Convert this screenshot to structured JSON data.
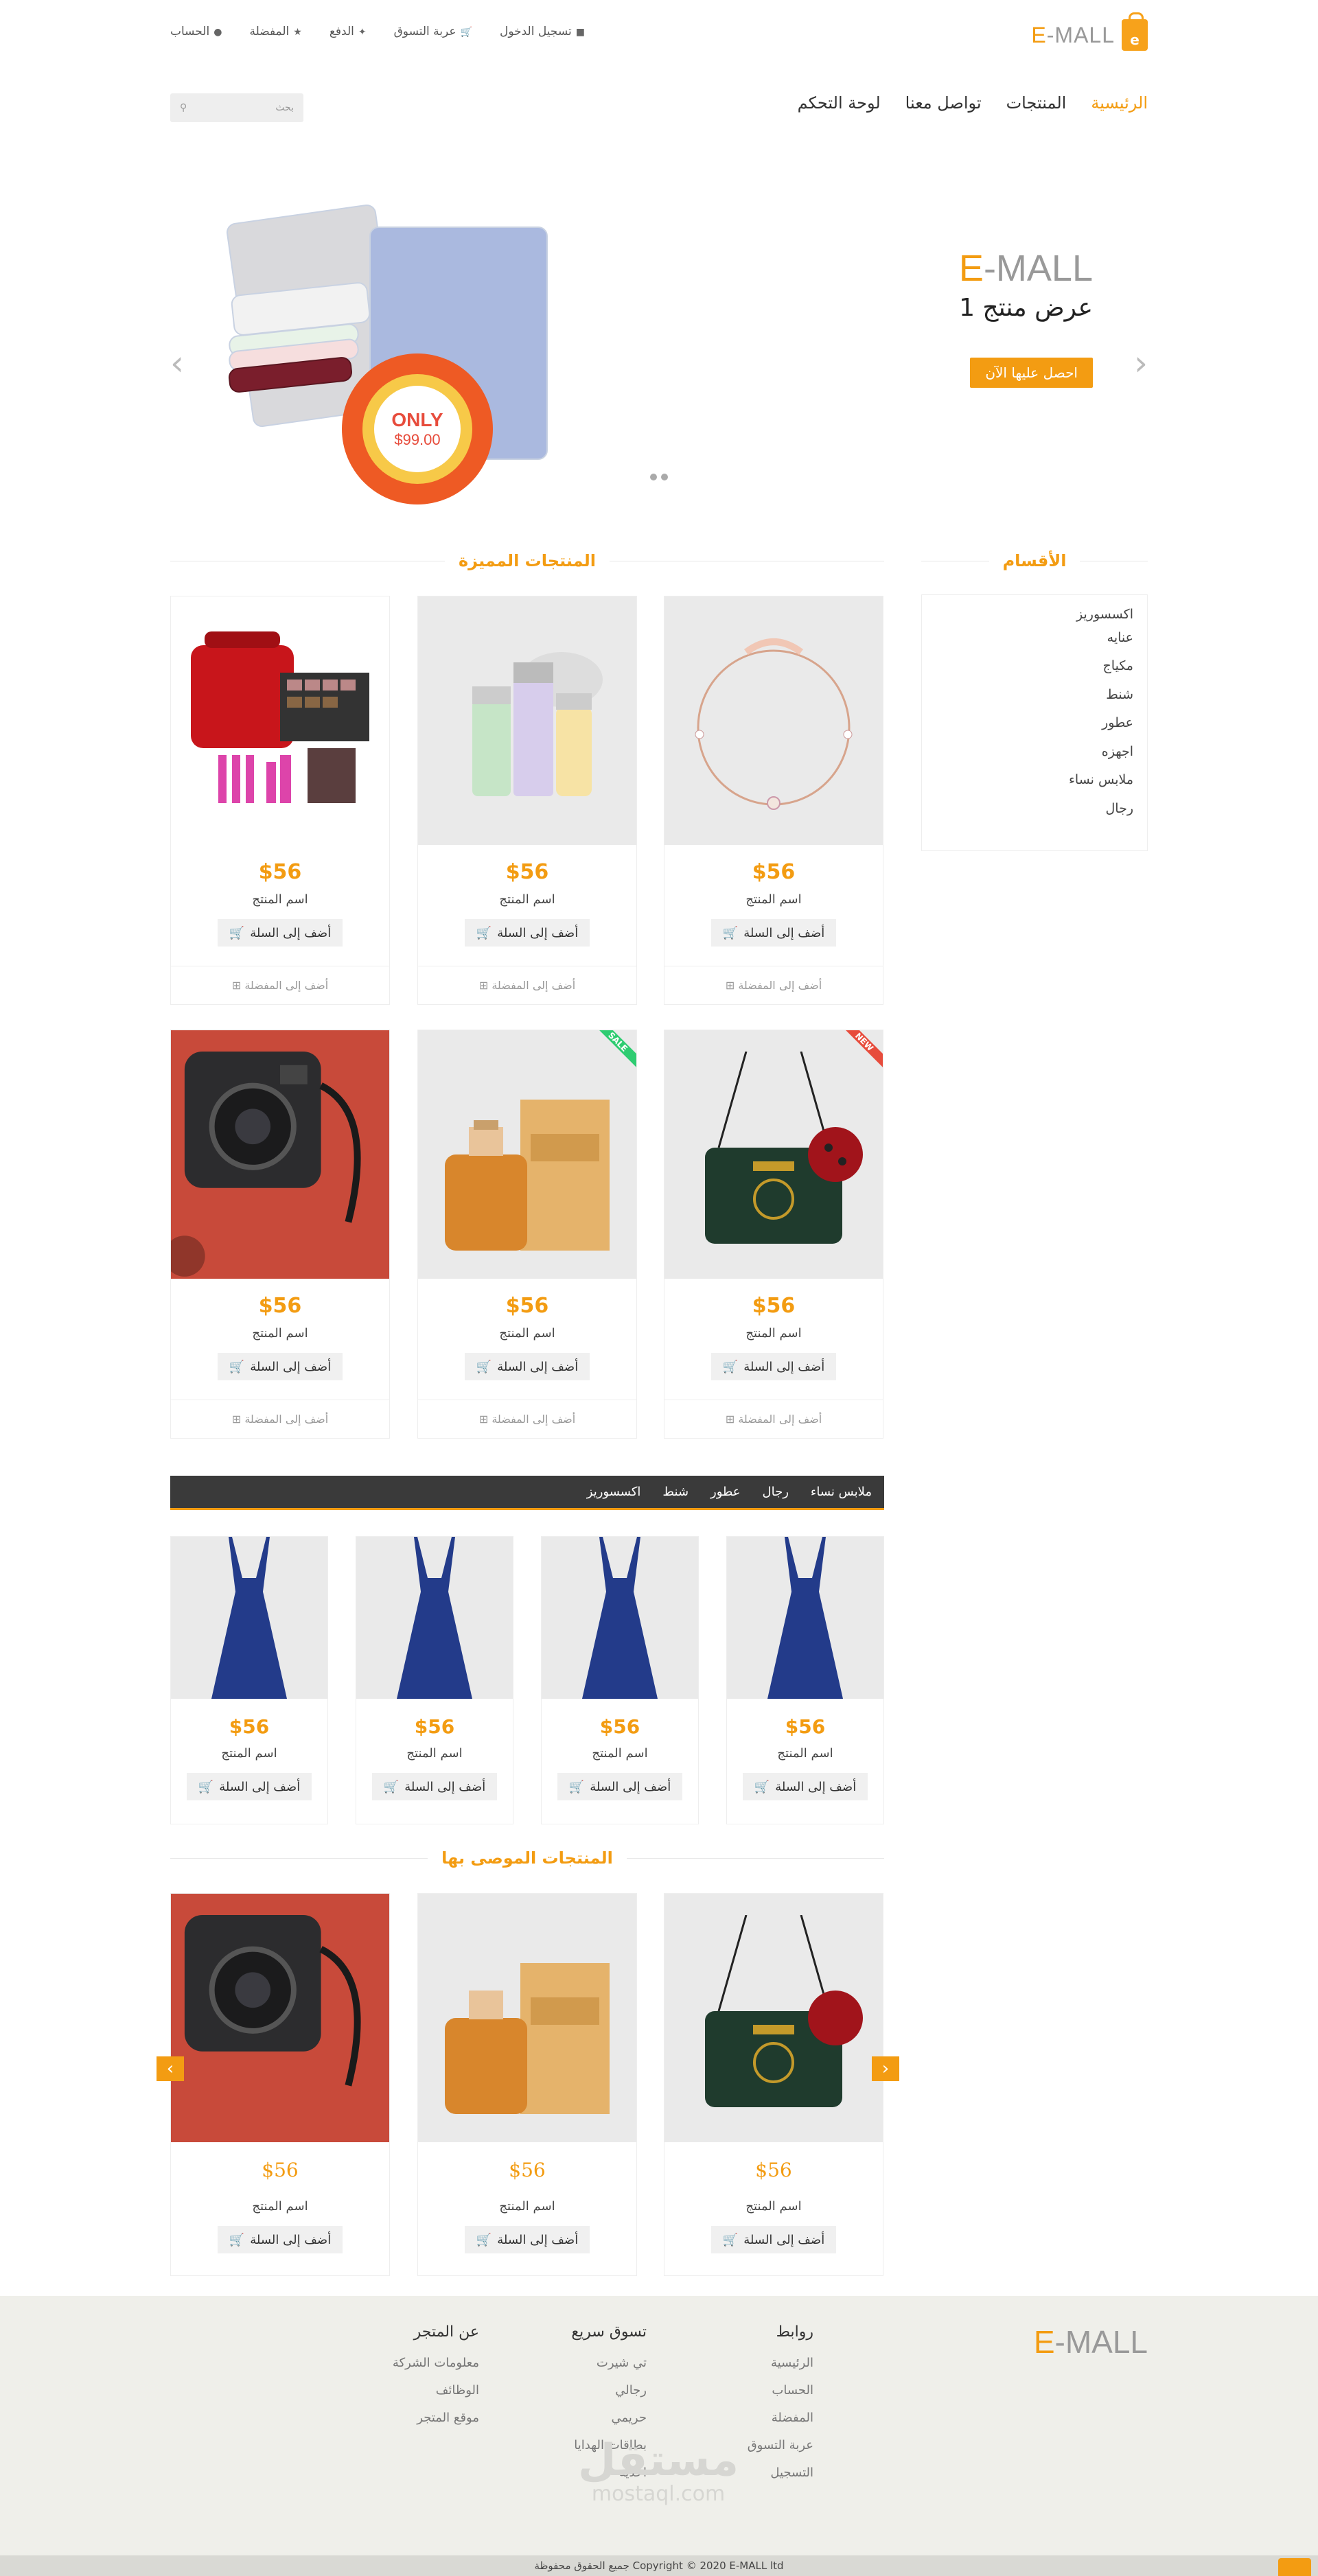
{
  "header": {
    "logo": {
      "prefix": "E",
      "rest": "-MALL",
      "icon_letter": "e"
    },
    "top_links": [
      {
        "label": "الحساب",
        "icon": "user-icon"
      },
      {
        "label": "المفضلة",
        "icon": "star-icon"
      },
      {
        "label": "الدفع",
        "icon": "crosshair-icon"
      },
      {
        "label": "عربة التسوق",
        "icon": "cart-icon"
      },
      {
        "label": "تسجيل الدخول",
        "icon": "lock-icon"
      }
    ],
    "menu": [
      "الرئيسية",
      "المنتجات",
      "تواصل معنا",
      "لوحة التحكم"
    ],
    "search_placeholder": "بحث"
  },
  "slider": {
    "brand_prefix": "E",
    "brand_rest": "-MALL",
    "title": "عرض منتج 1",
    "cta": "احصل عليها الآن",
    "badge_top": "ONLY",
    "badge_price": "$99.00"
  },
  "categories": {
    "title": "الأقسام",
    "items": [
      "اكسسوريز",
      "عنايه",
      "مكياج",
      "شنط",
      "عطور",
      "اجهزه",
      "ملابس نساء",
      "رجال"
    ]
  },
  "featured": {
    "title": "المنتجات المميزة",
    "products": [
      {
        "price": "$56",
        "name": "اسم المنتج",
        "add": "أضف إلى السلة",
        "fav": "أضف إلى المفضلة",
        "image": "bracelet"
      },
      {
        "price": "$56",
        "name": "اسم المنتج",
        "add": "أضف إلى السلة",
        "fav": "أضف إلى المفضلة",
        "image": "skincare"
      },
      {
        "price": "$56",
        "name": "اسم المنتج",
        "add": "أضف إلى السلة",
        "fav": "أضف إلى المفضلة",
        "image": "makeup-case"
      },
      {
        "price": "$56",
        "name": "اسم المنتج",
        "add": "أضف إلى السلة",
        "fav": "أضف إلى المفضلة",
        "image": "handbag",
        "ribbon": "NEW",
        "ribbon_color": "#e74c3c"
      },
      {
        "price": "$56",
        "name": "اسم المنتج",
        "add": "أضف إلى السلة",
        "fav": "أضف إلى المفضلة",
        "image": "perfume",
        "ribbon": "SALE",
        "ribbon_color": "#2ecc71"
      },
      {
        "price": "$56",
        "name": "اسم المنتج",
        "add": "أضف إلى السلة",
        "fav": "أضف إلى المفضلة",
        "image": "camera"
      }
    ]
  },
  "tabs": [
    "ملابس نساء",
    "رجال",
    "عطور",
    "شنط",
    "اكسسوريز"
  ],
  "tab_products": [
    {
      "price": "$56",
      "name": "اسم المنتج",
      "add": "أضف إلى السلة"
    },
    {
      "price": "$56",
      "name": "اسم المنتج",
      "add": "أضف إلى السلة"
    },
    {
      "price": "$56",
      "name": "اسم المنتج",
      "add": "أضف إلى السلة"
    },
    {
      "price": "$56",
      "name": "اسم المنتج",
      "add": "أضف إلى السلة"
    }
  ],
  "recommended": {
    "title": "المنتجات الموصى بها",
    "products": [
      {
        "price": "$56",
        "name": "اسم المنتج",
        "add": "أضف إلى السلة"
      },
      {
        "price": "$56",
        "name": "اسم المنتج",
        "add": "أضف إلى السلة"
      },
      {
        "price": "$56",
        "name": "اسم المنتج",
        "add": "أضف إلى السلة"
      }
    ]
  },
  "footer": {
    "logo_prefix": "E",
    "logo_rest": "-MALL",
    "columns": [
      {
        "title": "روابط",
        "items": [
          "الرئيسية",
          "الحساب",
          "المفضلة",
          "عربة التسوق",
          "التسجيل"
        ]
      },
      {
        "title": "تسوق سريع",
        "items": [
          "تي شيرت",
          "رجالي",
          "حريمي",
          "بطاقات الهدايا",
          "احذية"
        ]
      },
      {
        "title": "عن المتجر",
        "items": [
          "معلومات الشركة",
          "الوظائف",
          "موقع المتجر"
        ]
      }
    ],
    "copyright": "جميع الحقوق محفوظة Copyright © 2020 E-MALL ltd",
    "watermark_ar": "مستقل",
    "watermark_en": "mostaql.com"
  },
  "colors": {
    "accent": "#f39c12",
    "dark_bar": "#3a3a3a",
    "footer_bg": "#efefea"
  }
}
